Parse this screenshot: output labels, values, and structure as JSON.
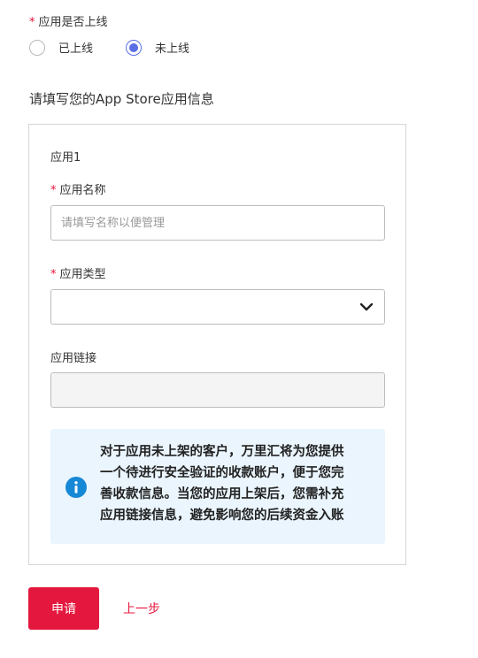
{
  "online_question": {
    "required_mark": "*",
    "label": "应用是否上线",
    "options": [
      {
        "label": "已上线",
        "checked": false
      },
      {
        "label": "未上线",
        "checked": true
      }
    ]
  },
  "section_title": "请填写您的App Store应用信息",
  "app_card": {
    "title": "应用1",
    "name_field": {
      "required_mark": "*",
      "label": "应用名称",
      "value": "",
      "placeholder": "请填写名称以便管理"
    },
    "type_field": {
      "required_mark": "*",
      "label": "应用类型",
      "value": "",
      "icon": "chevron-down-icon"
    },
    "link_field": {
      "label": "应用链接",
      "value": ""
    },
    "notice": {
      "icon": "info-icon",
      "lines": [
        "对于应用未上架的客户，万里汇将为您提供",
        "一个待进行安全验证的收款账户，便于您完",
        "善收款信息。当您的应用上架后，您需补充",
        "应用链接信息，避免影响您的后续资金入账"
      ]
    }
  },
  "actions": {
    "submit_label": "申请",
    "back_label": "上一步"
  },
  "colors": {
    "primary": "#e4183e",
    "radio_checked": "#5b6fe6",
    "notice_bg": "#eaf5fd",
    "info_icon": "#1788d6"
  }
}
